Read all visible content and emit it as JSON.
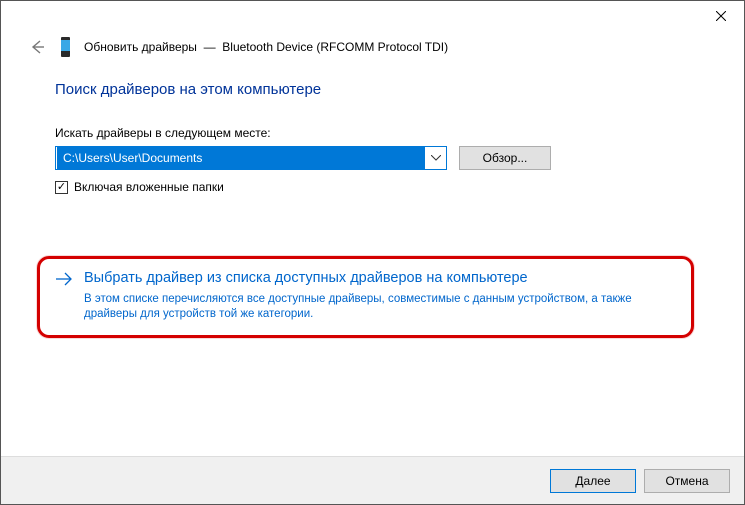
{
  "window": {
    "title_prefix": "Обновить драйверы",
    "title_device": "Bluetooth Device (RFCOMM Protocol TDI)"
  },
  "heading": "Поиск драйверов на этом компьютере",
  "path_section": {
    "label": "Искать драйверы в следующем месте:",
    "value": "C:\\Users\\User\\Documents",
    "browse": "Обзор...",
    "include_subfolders": "Включая вложенные папки",
    "include_checked": "✓"
  },
  "option": {
    "title": "Выбрать драйвер из списка доступных драйверов на компьютере",
    "desc": "В этом списке перечисляются все доступные драйверы, совместимые с данным устройством, а также драйверы для устройств той же категории."
  },
  "footer": {
    "next": "Далее",
    "cancel": "Отмена"
  }
}
